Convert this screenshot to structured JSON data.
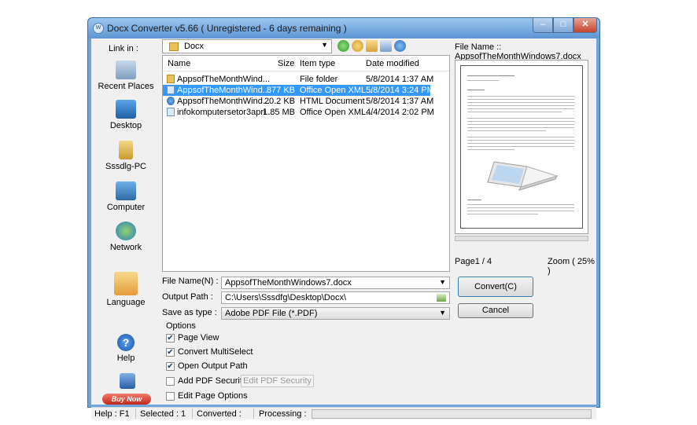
{
  "window": {
    "title": "Docx Converter v5.66 ( Unregistered  - 6 days remaining )"
  },
  "sidebar": {
    "link_in_label": "Link in :",
    "items": [
      {
        "label": "Recent Places",
        "icon": "recent-places-icon"
      },
      {
        "label": "Desktop",
        "icon": "desktop-icon"
      },
      {
        "label": "Sssdlg-PC",
        "icon": "user-folder-icon"
      },
      {
        "label": "Computer",
        "icon": "computer-icon"
      },
      {
        "label": "Network",
        "icon": "network-icon"
      },
      {
        "label": "Language",
        "icon": "language-icon"
      },
      {
        "label": "Help",
        "icon": "help-icon"
      }
    ],
    "buy_now": "Buy Now"
  },
  "toolbar": {
    "folder": "Docx"
  },
  "file_list": {
    "columns": [
      "Name",
      "Size",
      "Item type",
      "Date modified"
    ],
    "rows": [
      {
        "name": "AppsofTheMonthWind...",
        "size": "",
        "type": "File folder",
        "date": "5/8/2014 1:37 AM"
      },
      {
        "name": "AppsofTheMonthWind...",
        "size": "877 KB",
        "type": "Office Open XML...",
        "date": "5/8/2014 3:24 PM"
      },
      {
        "name": "AppsofTheMonthWind...",
        "size": "20.2 KB",
        "type": "HTML Document",
        "date": "5/8/2014 1:37 AM"
      },
      {
        "name": "infokomputersetor3apri...",
        "size": "1.85 MB",
        "type": "Office Open XML...",
        "date": "4/4/2014 2:02 PM"
      }
    ]
  },
  "form": {
    "file_name_label": "File Name(N) :",
    "file_name_value": "AppsofTheMonthWindows7.docx",
    "output_path_label": "Output Path :",
    "output_path_value": "C:\\Users\\Sssdfg\\Desktop\\Docx\\",
    "save_as_label": "Save as type :",
    "save_as_value": "Adobe PDF File (*.PDF)"
  },
  "options": {
    "title": "Options",
    "page_view": "Page View",
    "convert_multiselect": "Convert MultiSelect",
    "open_output_path": "Open Output Path",
    "add_pdf_security": "Add PDF Security",
    "edit_pdf_security": "Edit PDF Security",
    "edit_page_options": "Edit Page Options"
  },
  "preview": {
    "file_name": "File Name :: AppsofTheMonthWindows7.docx",
    "page": "Page1 / 4",
    "zoom": "Zoom ( 25% )"
  },
  "buttons": {
    "convert": "Convert(C)",
    "cancel": "Cancel"
  },
  "statusbar": {
    "help": "Help : F1",
    "selected": "Selected : 1",
    "converted": "Converted :",
    "processing": "Processing :"
  }
}
